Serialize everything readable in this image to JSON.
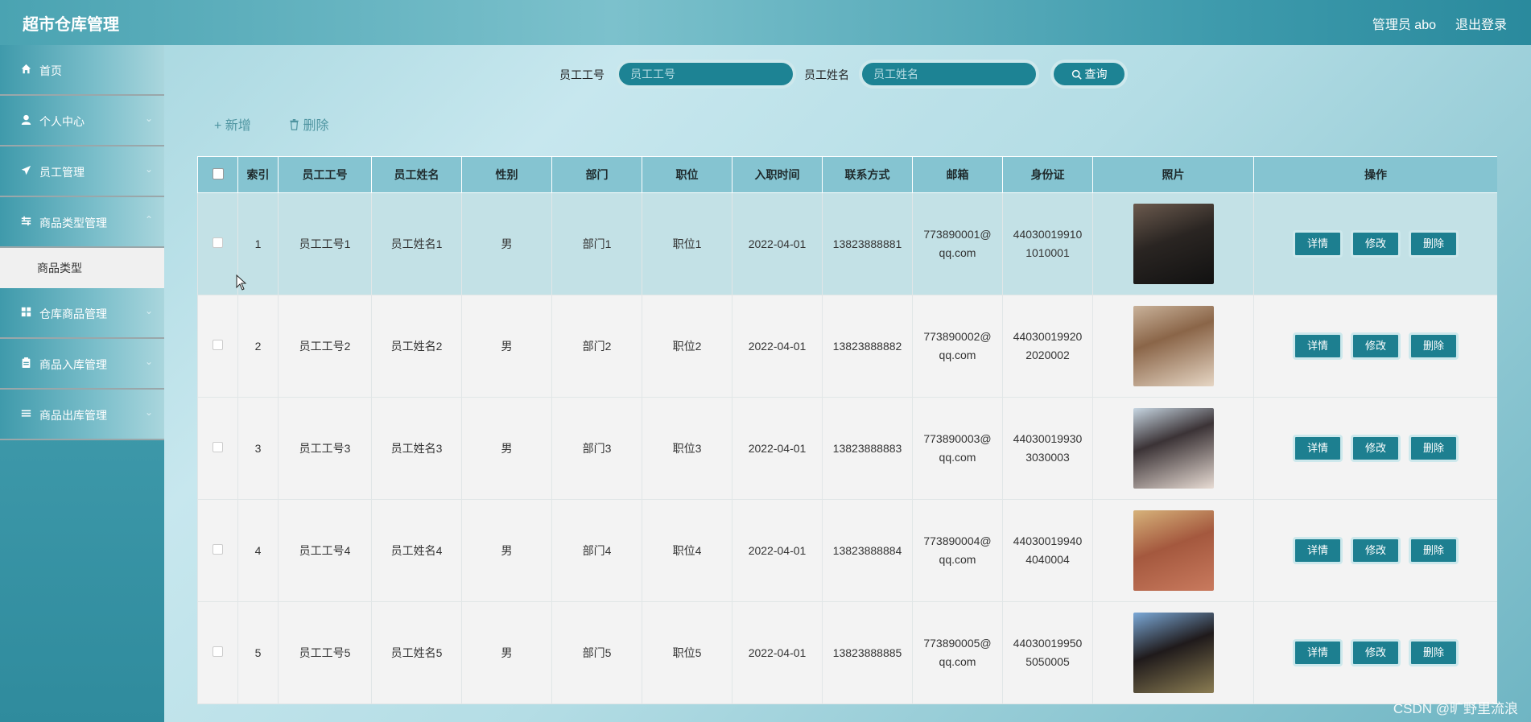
{
  "header": {
    "title": "超市仓库管理",
    "admin_label": "管理员 abo",
    "logout_label": "退出登录"
  },
  "sidebar": {
    "items": [
      {
        "label": "首页",
        "icon": "home-icon",
        "has_chevron": false
      },
      {
        "label": "个人中心",
        "icon": "user-icon",
        "has_chevron": true
      },
      {
        "label": "员工管理",
        "icon": "send-icon",
        "has_chevron": true
      },
      {
        "label": "商品类型管理",
        "icon": "sliders-icon",
        "has_chevron": true
      },
      {
        "label": "仓库商品管理",
        "icon": "grid-icon",
        "has_chevron": true
      },
      {
        "label": "商品入库管理",
        "icon": "clipboard-icon",
        "has_chevron": true
      },
      {
        "label": "商品出库管理",
        "icon": "list-icon",
        "has_chevron": true
      }
    ],
    "submenu": {
      "label": "商品类型"
    }
  },
  "search": {
    "field1_label": "员工工号",
    "field1_placeholder": "员工工号",
    "field2_label": "员工姓名",
    "field2_placeholder": "员工姓名",
    "button_label": "查询"
  },
  "actions": {
    "add_label": "新增",
    "delete_label": "删除"
  },
  "table": {
    "columns": [
      "",
      "索引",
      "员工工号",
      "员工姓名",
      "性别",
      "部门",
      "职位",
      "入职时间",
      "联系方式",
      "邮箱",
      "身份证",
      "照片",
      "操作"
    ],
    "rows": [
      {
        "index": "1",
        "emp_no": "员工工号1",
        "name": "员工姓名1",
        "gender": "男",
        "dept": "部门1",
        "position": "职位1",
        "date": "2022-04-01",
        "phone": "13823888881",
        "email": "773890001@qq.com",
        "id_card": "440300199101010001"
      },
      {
        "index": "2",
        "emp_no": "员工工号2",
        "name": "员工姓名2",
        "gender": "男",
        "dept": "部门2",
        "position": "职位2",
        "date": "2022-04-01",
        "phone": "13823888882",
        "email": "773890002@qq.com",
        "id_card": "440300199202020002"
      },
      {
        "index": "3",
        "emp_no": "员工工号3",
        "name": "员工姓名3",
        "gender": "男",
        "dept": "部门3",
        "position": "职位3",
        "date": "2022-04-01",
        "phone": "13823888883",
        "email": "773890003@qq.com",
        "id_card": "440300199303030003"
      },
      {
        "index": "4",
        "emp_no": "员工工号4",
        "name": "员工姓名4",
        "gender": "男",
        "dept": "部门4",
        "position": "职位4",
        "date": "2022-04-01",
        "phone": "13823888884",
        "email": "773890004@qq.com",
        "id_card": "440300199404040004"
      },
      {
        "index": "5",
        "emp_no": "员工工号5",
        "name": "员工姓名5",
        "gender": "男",
        "dept": "部门5",
        "position": "职位5",
        "date": "2022-04-01",
        "phone": "13823888885",
        "email": "773890005@qq.com",
        "id_card": "440300199505050005"
      }
    ],
    "op_labels": {
      "detail": "详情",
      "edit": "修改",
      "delete": "删除"
    }
  },
  "watermark": "CSDN @旷野里流浪",
  "colors": {
    "accent": "#1d8394",
    "header_bg": "#4aa3b2",
    "table_header_bg": "#85c4d1",
    "row_highlight": "#c3e1e6"
  }
}
